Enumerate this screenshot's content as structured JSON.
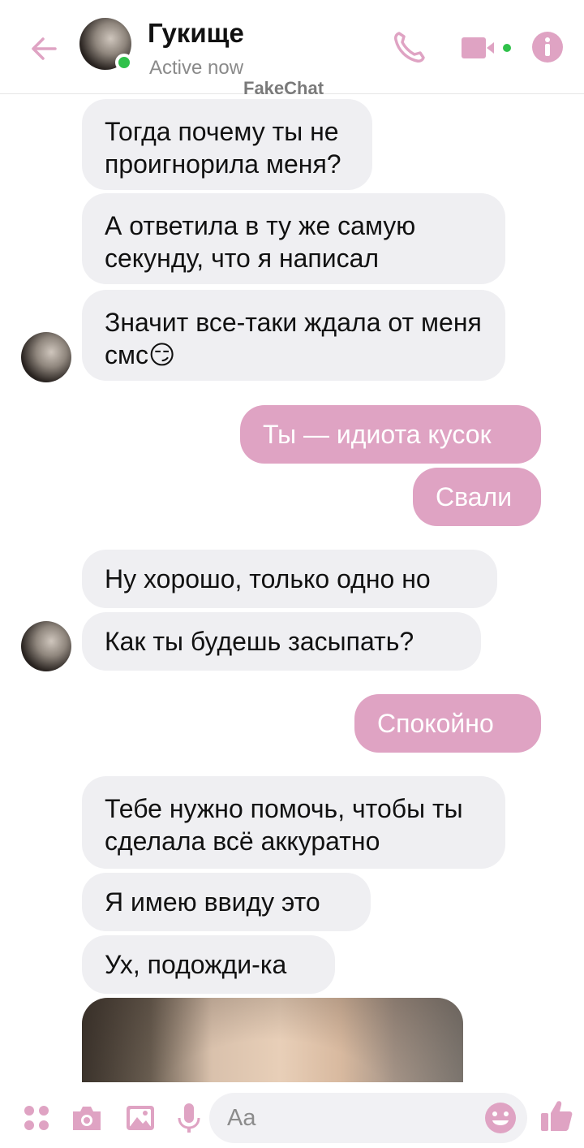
{
  "header": {
    "contact_name": "Гукище",
    "status": "Active now",
    "watermark": "FakeChat"
  },
  "colors": {
    "accent": "#dfa3c3",
    "incoming_bubble": "#efeff2",
    "online": "#2fc14a"
  },
  "icons": [
    "back-arrow-icon",
    "phone-icon",
    "video-camera-icon",
    "info-icon",
    "apps-icon",
    "camera-icon",
    "image-icon",
    "microphone-icon",
    "emoji-icon",
    "thumbs-up-icon"
  ],
  "messages": [
    {
      "dir": "in",
      "text": "Тогда почему ты не проигнорила меня?"
    },
    {
      "dir": "in",
      "text": "А ответила в ту же самую секунду, что я написал"
    },
    {
      "dir": "in",
      "text": "Значит все-таки ждала от меня смс😏"
    },
    {
      "dir": "out",
      "text": "Ты — идиота кусок"
    },
    {
      "dir": "out",
      "text": "Свали"
    },
    {
      "dir": "in",
      "text": "Ну хорошо, только одно но"
    },
    {
      "dir": "in",
      "text": "Как ты будешь засыпать?"
    },
    {
      "dir": "out",
      "text": "Спокойно"
    },
    {
      "dir": "in",
      "text": "Тебе нужно помочь, чтобы ты сделала всё аккуратно"
    },
    {
      "dir": "in",
      "text": "Я имею ввиду это"
    },
    {
      "dir": "in",
      "text": "Ух, подожди-ка"
    }
  ],
  "composer": {
    "placeholder": "Aa"
  }
}
